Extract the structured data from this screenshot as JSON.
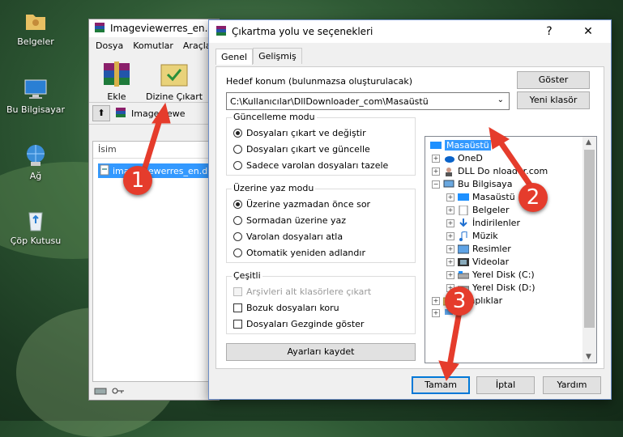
{
  "desktop": {
    "icons": [
      {
        "label": "Belgeler",
        "icon": "folder-user-icon"
      },
      {
        "label": "Bu Bilgisayar",
        "icon": "computer-icon"
      },
      {
        "label": "Ağ",
        "icon": "network-icon"
      },
      {
        "label": "Çöp Kutusu",
        "icon": "recycle-bin-icon"
      }
    ]
  },
  "winrar": {
    "title": "Imageviewerres_en.d",
    "menu": [
      "Dosya",
      "Komutlar",
      "Araçla"
    ],
    "toolbar": {
      "add_label": "Ekle",
      "extract_label": "Dizine Çıkart"
    },
    "address": "Imageviewe",
    "column_name": "İsim",
    "file_name": "imageviewerres_en.dll"
  },
  "dialog": {
    "title": "Çıkartma yolu ve seçenekleri",
    "help_glyph": "?",
    "close_glyph": "✕",
    "tabs": [
      "Genel",
      "Gelişmiş"
    ],
    "target_label": "Hedef konum (bulunmazsa oluşturulacak)",
    "target_path": "C:\\Kullanıcılar\\DllDownloader_com\\Masaüstü",
    "show_button": "Göster",
    "new_folder_button": "Yeni klasör",
    "update_mode": {
      "title": "Güncelleme modu",
      "options": [
        "Dosyaları çıkart ve değiştir",
        "Dosyaları çıkart ve güncelle",
        "Sadece varolan dosyaları tazele"
      ],
      "selected": 0
    },
    "overwrite_mode": {
      "title": "Üzerine yaz modu",
      "options": [
        "Üzerine yazmadan önce sor",
        "Sormadan üzerine yaz",
        "Varolan dosyaları atla",
        "Otomatik yeniden adlandır"
      ],
      "selected": 0
    },
    "misc": {
      "title": "Çeşitli",
      "options": [
        "Arşivleri alt klasörlere çıkart",
        "Bozuk dosyaları koru",
        "Dosyaları Gezginde göster"
      ],
      "disabled": [
        true,
        false,
        false
      ]
    },
    "save_settings_button": "Ayarları kaydet",
    "tree": [
      {
        "label": "Masaüstü",
        "level": 0,
        "expander": "",
        "icon": "desktop-icon",
        "selected": true
      },
      {
        "label": "OneD",
        "level": 1,
        "expander": "+",
        "icon": "onedrive-icon"
      },
      {
        "label": "DLL Do",
        "label2": "nloader.com",
        "level": 1,
        "expander": "+",
        "icon": "user-icon"
      },
      {
        "label": "Bu Bilgisaya",
        "level": 1,
        "expander": "−",
        "icon": "computer-icon"
      },
      {
        "label": "Masaüstü",
        "level": 2,
        "expander": "+",
        "icon": "desktop-icon"
      },
      {
        "label": "Belgeler",
        "level": 2,
        "expander": "+",
        "icon": "documents-icon"
      },
      {
        "label": "İndirilenler",
        "level": 2,
        "expander": "+",
        "icon": "downloads-icon"
      },
      {
        "label": "Müzik",
        "level": 2,
        "expander": "+",
        "icon": "music-icon"
      },
      {
        "label": "Resimler",
        "level": 2,
        "expander": "+",
        "icon": "pictures-icon"
      },
      {
        "label": "Videolar",
        "level": 2,
        "expander": "+",
        "icon": "videos-icon"
      },
      {
        "label": "Yerel Disk (C:)",
        "level": 2,
        "expander": "+",
        "icon": "disk-icon"
      },
      {
        "label": "Yerel Disk (D:)",
        "level": 2,
        "expander": "+",
        "icon": "disk-icon"
      },
      {
        "label": "Kitaplıklar",
        "level": 1,
        "expander": "+",
        "icon": "libraries-icon"
      },
      {
        "label": "",
        "level": 1,
        "expander": "+",
        "icon": "network-icon"
      }
    ],
    "ok_button": "Tamam",
    "cancel_button": "İptal",
    "help_button": "Yardım"
  },
  "annotations": [
    "1",
    "2",
    "3"
  ],
  "colors": {
    "accent": "#0078d7",
    "selection": "#3399ff",
    "annotation": "#e53c2c"
  }
}
